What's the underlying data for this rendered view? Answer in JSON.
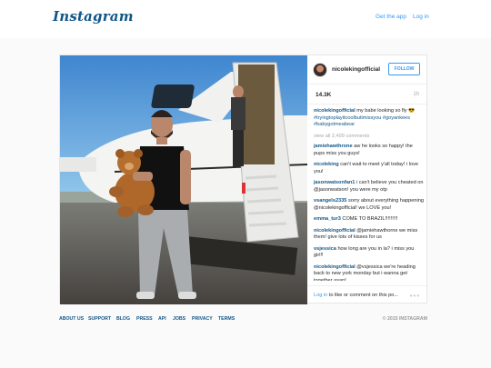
{
  "topbar": {
    "logo": "Instagram",
    "get_app": "Get the app",
    "log_in": "Log in"
  },
  "post": {
    "username": "nicolekingofficial",
    "follow_label": "FOLLOW",
    "likes": "14.3K",
    "age": "1h",
    "caption": {
      "user": "nicolekingofficial",
      "text": " my babe looking so fly 😎 ",
      "tags": "#tryingtoplayitcoolbutimissyou #goyankees #babygotmeabear"
    },
    "view_all": "view all 2,499 comments",
    "comments": [
      {
        "user": "jamiehawthrone",
        "text": " aw he looks so happy! the pups miss you guys!"
      },
      {
        "user": "nicoleking",
        "text": " can't wait to meet y'all today! i love you!"
      },
      {
        "user": "jasonwatsonfan1",
        "text": " i can't believe you cheated on @jasonwatson! you were my otp"
      },
      {
        "user": "vsangels2335",
        "text": " sorry about everything happening @nicolekingofficial! we LOVE you!"
      },
      {
        "user": "emma_tur3",
        "text": " COME TO BRAZIL!!!!!!!!!"
      },
      {
        "user": "nicolekingofficial",
        "text": " @jamiehawthorne we miss them! give lots of kisses for us"
      },
      {
        "user": "vsjessica",
        "text": " how long are you in la? i miss you girl!!"
      },
      {
        "user": "nicolekingofficial",
        "text": " @vsjessica we're heading back to new york monday but i wanna get together asap!"
      }
    ],
    "login_link": "Log in",
    "login_rest": " to like or comment on this po...",
    "more_icon": "more-options-icon"
  },
  "footer": {
    "links": [
      "ABOUT US",
      "SUPPORT",
      "BLOG",
      "PRESS",
      "API",
      "JOBS",
      "PRIVACY",
      "TERMS"
    ],
    "copyright": "© 2015 INSTAGRAM"
  },
  "colors": {
    "brand": "#125688",
    "link": "#3897f0",
    "muted": "#a5a7aa"
  }
}
